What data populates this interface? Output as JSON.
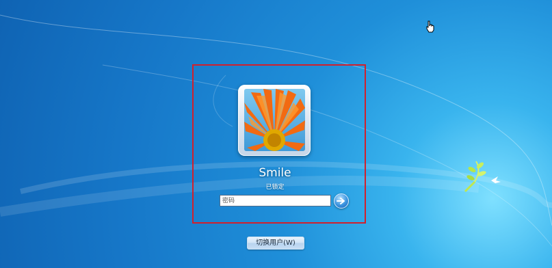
{
  "user": {
    "name": "Smile",
    "status": "已锁定"
  },
  "password": {
    "placeholder": "密码",
    "value": ""
  },
  "buttons": {
    "switch_user_label": "切换用户(W)",
    "submit_icon": "arrow-right-icon"
  },
  "icons": {
    "cursor": "hand-cursor-icon",
    "avatar": "orange-flower-avatar",
    "logo": "bird-leaf-logo"
  },
  "colors": {
    "highlight": "#d21f2b",
    "background": "#1f8fd9"
  }
}
